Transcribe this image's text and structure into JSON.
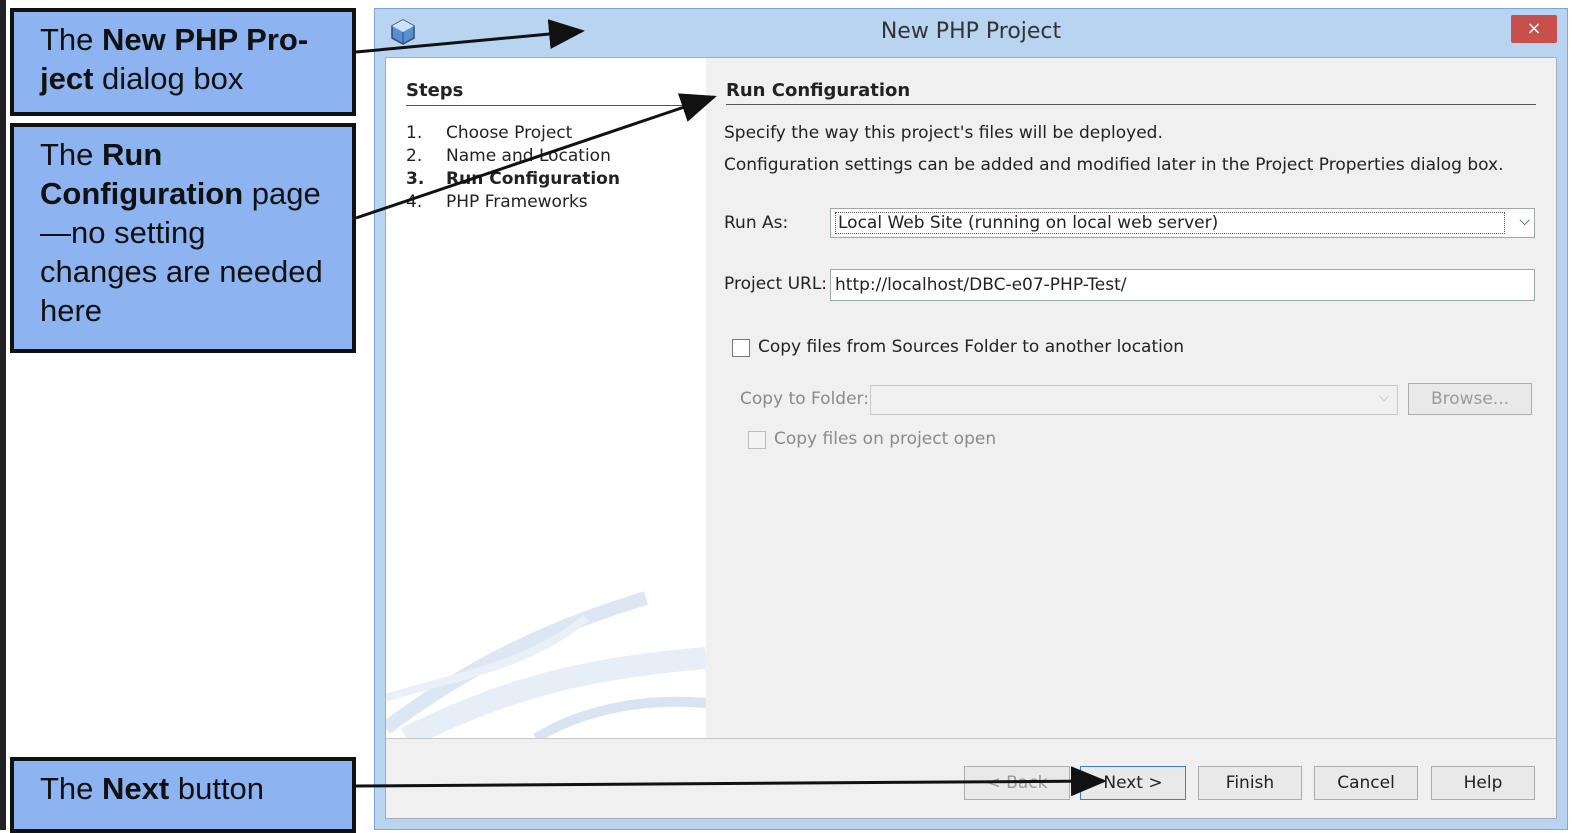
{
  "callouts": {
    "dialog": {
      "prefix": "The ",
      "bold": "New PHP Pro-ject",
      "suffix": " dialog box"
    },
    "runconfig": {
      "prefix": "The ",
      "bold": "Run Configuration",
      "suffix": " page—no setting changes are needed here"
    },
    "next": {
      "prefix": "The ",
      "bold": "Next",
      "suffix": " button"
    }
  },
  "dialog": {
    "title": "New PHP Project",
    "close_label": "×"
  },
  "steps": {
    "title": "Steps",
    "items": [
      {
        "num": "1.",
        "label": "Choose Project"
      },
      {
        "num": "2.",
        "label": "Name and Location"
      },
      {
        "num": "3.",
        "label": "Run Configuration"
      },
      {
        "num": "4.",
        "label": "PHP Frameworks"
      }
    ]
  },
  "content": {
    "title": "Run Configuration",
    "desc1": "Specify the way this project's files will be deployed.",
    "desc2": "Configuration settings can be added and modified later in the Project Properties dialog box.",
    "run_as_label": "Run As:",
    "run_as_value": "Local Web Site (running on local web server)",
    "url_label": "Project URL:",
    "url_value": "http://localhost/DBC-e07-PHP-Test/",
    "copy_files_label": "Copy files from Sources Folder to another location",
    "copy_folder_label": "Copy to Folder:",
    "browse_label": "Browse...",
    "copy_on_open_label": "Copy files on project open"
  },
  "buttons": {
    "back": "< Back",
    "next": "Next >",
    "finish": "Finish",
    "cancel": "Cancel",
    "help": "Help"
  }
}
